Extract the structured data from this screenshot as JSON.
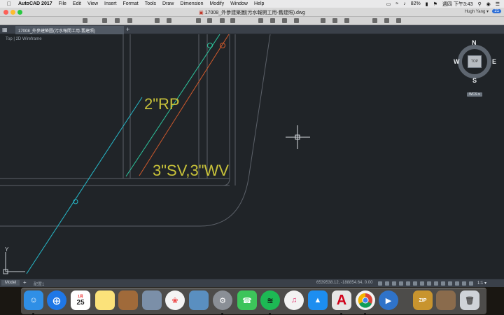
{
  "menubar": {
    "app_name": "AutoCAD 2017",
    "menus": [
      "File",
      "Edit",
      "View",
      "Insert",
      "Format",
      "Tools",
      "Draw",
      "Dimension",
      "Modify",
      "Window",
      "Help"
    ],
    "battery": "82%",
    "clock": "週四 下午3:43"
  },
  "window": {
    "title": "17008_外參建築圖(污水報開工用-舊建照).dwg",
    "user": "Hugh Yang",
    "notifications": "21"
  },
  "doc_tab": {
    "label": "17008_外參建築圖(污水報開工用-舊建照)"
  },
  "viewport_label": "Top  |  2D Wireframe",
  "drawing": {
    "label_rp": "2\"RP",
    "label_sv_wv": "3\"SV,3\"WV",
    "ucs_y": "Y",
    "colors": {
      "cyan_line": "#26b9c9",
      "green_line": "#2ec9a0",
      "orange_line": "#d15a2c",
      "label": "#c8c23a",
      "gray_line": "#5b6068"
    }
  },
  "viewcube": {
    "n": "N",
    "s": "S",
    "e": "E",
    "w": "W",
    "top": "TOP",
    "wcs": "WCS"
  },
  "statusbar": {
    "model_tab": "Model",
    "layout_tab": "配置1",
    "coordinates": "6539538.12, -188854.64, 0.00",
    "scale": "1:1"
  },
  "dock": {
    "calendar_day": "25",
    "calendar_month": "1月",
    "zip_label": "ZIP",
    "autocad_letter": "A"
  }
}
